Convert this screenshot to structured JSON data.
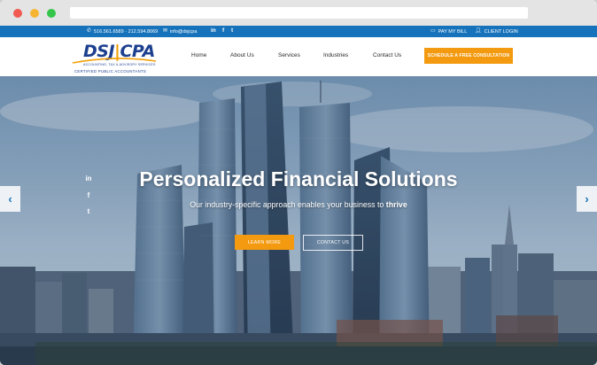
{
  "topbar": {
    "phone": "516.561.6589 · 212.594.8069",
    "email": "info@dsjcpa",
    "social": [
      "in",
      "f",
      "t"
    ],
    "pay_bill": "PAY MY BILL",
    "client_login": "CLIENT LOGIN"
  },
  "logo": {
    "brand_left": "DSJ",
    "brand_right": "CPA",
    "tagline": "ACCOUNTING, TAX & ADVISORY SERVICES",
    "subtitle": "CERTIFIED PUBLIC ACCOUNTANTS"
  },
  "nav": {
    "items": [
      "Home",
      "About Us",
      "Services",
      "Industries",
      "Contact Us"
    ],
    "cta": "SCHEDULE A FREE CONSULTATION"
  },
  "hero": {
    "title": "Personalized Financial Solutions",
    "subtitle_prefix": "Our industry-specific approach enables your business to ",
    "subtitle_emphasis": "thrive",
    "learn_more": "LEARN MORE",
    "contact_us": "CONTACT US",
    "prev_arrow": "‹",
    "next_arrow": "›",
    "social": [
      "in",
      "f",
      "t"
    ]
  },
  "colors": {
    "accent": "#f39a10",
    "brand_blue": "#1673bb",
    "logo_navy": "#1d3f8f"
  }
}
